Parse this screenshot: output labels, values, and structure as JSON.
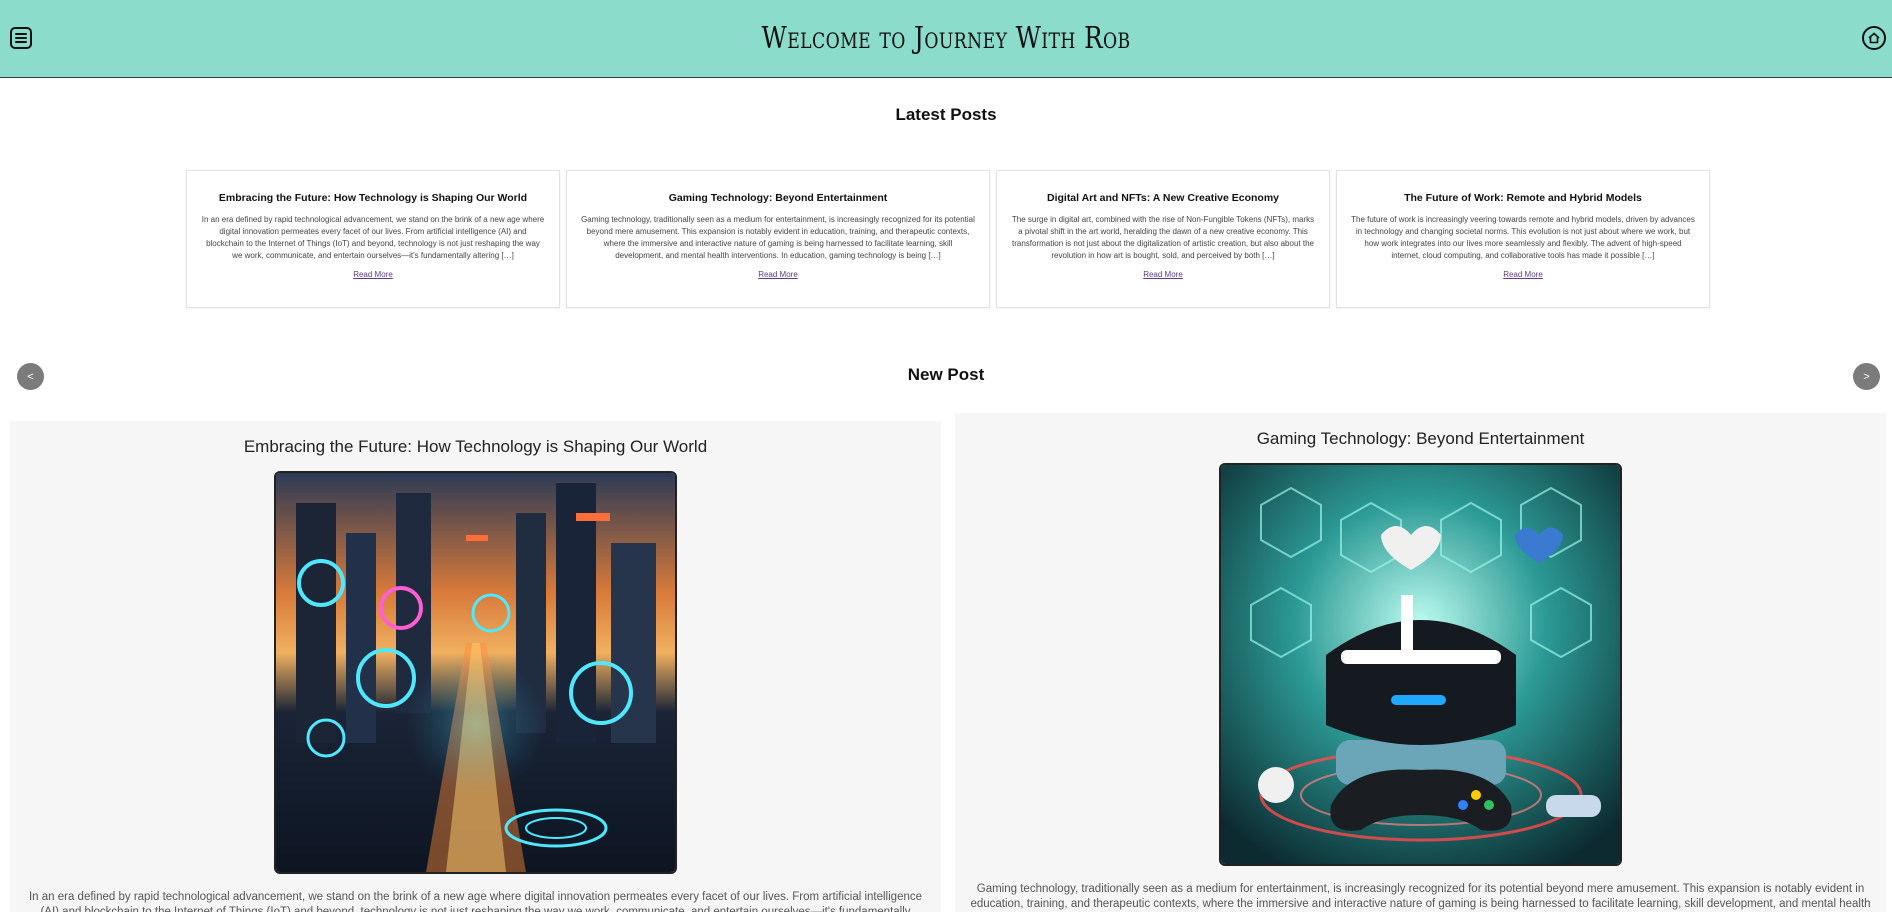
{
  "header": {
    "title": "Welcome to Journey With Rob",
    "menu_icon": "menu-icon",
    "home_icon": "home-icon",
    "background_color": "#8cdccb"
  },
  "latest_posts": {
    "heading": "Latest Posts",
    "posts": [
      {
        "title": "Embracing the Future: How Technology is Shaping Our World",
        "excerpt": "In an era defined by rapid technological advancement, we stand on the brink of a new age where digital innovation permeates every facet of our lives. From artificial intelligence (AI) and blockchain to the Internet of Things (IoT) and beyond, technology is not just reshaping the way we work, communicate, and entertain ourselves—it's fundamentally altering […]",
        "link": "Read More"
      },
      {
        "title": "Gaming Technology: Beyond Entertainment",
        "excerpt": "Gaming technology, traditionally seen as a medium for entertainment, is increasingly recognized for its potential beyond mere amusement. This expansion is notably evident in education, training, and therapeutic contexts, where the immersive and interactive nature of gaming is being harnessed to facilitate learning, skill development, and mental health interventions. In education, gaming technology is being […]",
        "link": "Read More"
      },
      {
        "title": "Digital Art and NFTs: A New Creative Economy",
        "excerpt": "The surge in digital art, combined with the rise of Non-Fungible Tokens (NFTs), marks a pivotal shift in the art world, heralding the dawn of a new creative economy. This transformation is not just about the digitalization of artistic creation, but also about the revolution in how art is bought, sold, and perceived by both […]",
        "link": "Read More"
      },
      {
        "title": "The Future of Work: Remote and Hybrid Models",
        "excerpt": "The future of work is increasingly veering towards remote and hybrid models, driven by advances in technology and changing societal norms. This evolution is not just about where we work, but how work integrates into our lives more seamlessly and flexibly. The advent of high-speed internet, cloud computing, and collaborative tools has made it possible […]",
        "link": "Read More"
      }
    ]
  },
  "new_post": {
    "heading": "New Post",
    "prev_label": "<",
    "next_label": ">",
    "slides": [
      {
        "title": "Embracing the Future: How Technology is Shaping Our World",
        "image_icon": "smart-city-illustration",
        "excerpt": "In an era defined by rapid technological advancement, we stand on the brink of a new age where digital innovation permeates every facet of our lives. From artificial intelligence (AI) and blockchain to the Internet of Things (IoT) and beyond, technology is not just reshaping the way we work, communicate, and entertain ourselves—it's fundamentally altering […]"
      },
      {
        "title": "Gaming Technology: Beyond Entertainment",
        "image_icon": "vr-headset-illustration",
        "excerpt": "Gaming technology, traditionally seen as a medium for entertainment, is increasingly recognized for its potential beyond mere amusement. This expansion is notably evident in education, training, and therapeutic contexts, where the immersive and interactive nature of gaming is being harnessed to facilitate learning, skill development, and mental health interventions. In"
      }
    ]
  }
}
